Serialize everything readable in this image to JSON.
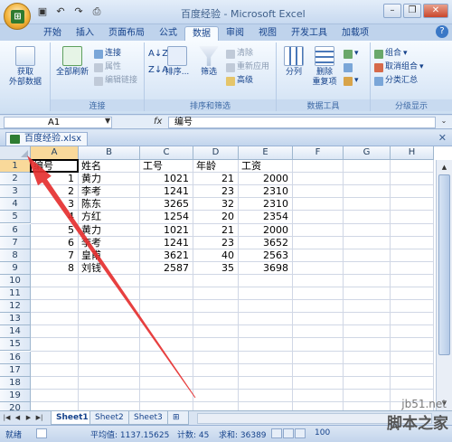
{
  "window": {
    "title": "百度经验 - Microsoft Excel",
    "qat_icons": [
      "save-icon",
      "undo-icon",
      "redo-icon",
      "print-icon"
    ]
  },
  "tabs": [
    "开始",
    "插入",
    "页面布局",
    "公式",
    "数据",
    "审阅",
    "视图",
    "开发工具",
    "加载项"
  ],
  "active_tab": "数据",
  "ribbon": {
    "get_external": "获取\n外部数据",
    "refresh_all": "全部刷新",
    "connections": "连接",
    "properties": "属性",
    "edit_links": "编辑链接",
    "group_connections": "连接",
    "sort": "排序...",
    "filter": "筛选",
    "clear": "清除",
    "reapply": "重新应用",
    "advanced": "高级",
    "group_sort_filter": "排序和筛选",
    "text_to_columns": "分列",
    "remove_duplicates": "删除\n重复项",
    "group_data_tools": "数据工具",
    "group": "组合",
    "ungroup": "取消组合",
    "subtotal": "分类汇总",
    "group_outline": "分级显示"
  },
  "formula_bar": {
    "name_box": "A1",
    "fx": "fx",
    "content": "编号"
  },
  "workbook": {
    "filename": "百度经验.xlsx"
  },
  "columns": [
    "A",
    "B",
    "C",
    "D",
    "E",
    "F",
    "G",
    "H"
  ],
  "rows": [
    "1",
    "2",
    "3",
    "4",
    "5",
    "6",
    "7",
    "8",
    "9",
    "10",
    "11",
    "12",
    "13",
    "14",
    "15",
    "16",
    "17",
    "18",
    "19",
    "20"
  ],
  "headers": [
    "编号",
    "姓名",
    "工号",
    "年龄",
    "工资"
  ],
  "table": [
    [
      "1",
      "黄力",
      "1021",
      "21",
      "2000"
    ],
    [
      "2",
      "李考",
      "1241",
      "23",
      "2310"
    ],
    [
      "3",
      "陈东",
      "3265",
      "32",
      "2310"
    ],
    [
      "4",
      "方红",
      "1254",
      "20",
      "2354"
    ],
    [
      "5",
      "黄力",
      "1021",
      "21",
      "2000"
    ],
    [
      "6",
      "李考",
      "1241",
      "23",
      "3652"
    ],
    [
      "7",
      "皇甫",
      "3621",
      "40",
      "2563"
    ],
    [
      "8",
      "刘钱",
      "2587",
      "35",
      "3698"
    ]
  ],
  "sheets": [
    "Sheet1",
    "Sheet2",
    "Sheet3"
  ],
  "active_sheet": "Sheet1",
  "status": {
    "ready": "就绪",
    "average": "平均值: 1137.15625",
    "count": "计数: 45",
    "sum": "求和: 36389",
    "zoom": "100"
  },
  "watermark": {
    "site": "jb51.net",
    "brand": "脚本之家"
  },
  "colors": {
    "annotation_arrow": "#e53030",
    "selection": "#000000",
    "header_selected": "#f9d99a"
  }
}
